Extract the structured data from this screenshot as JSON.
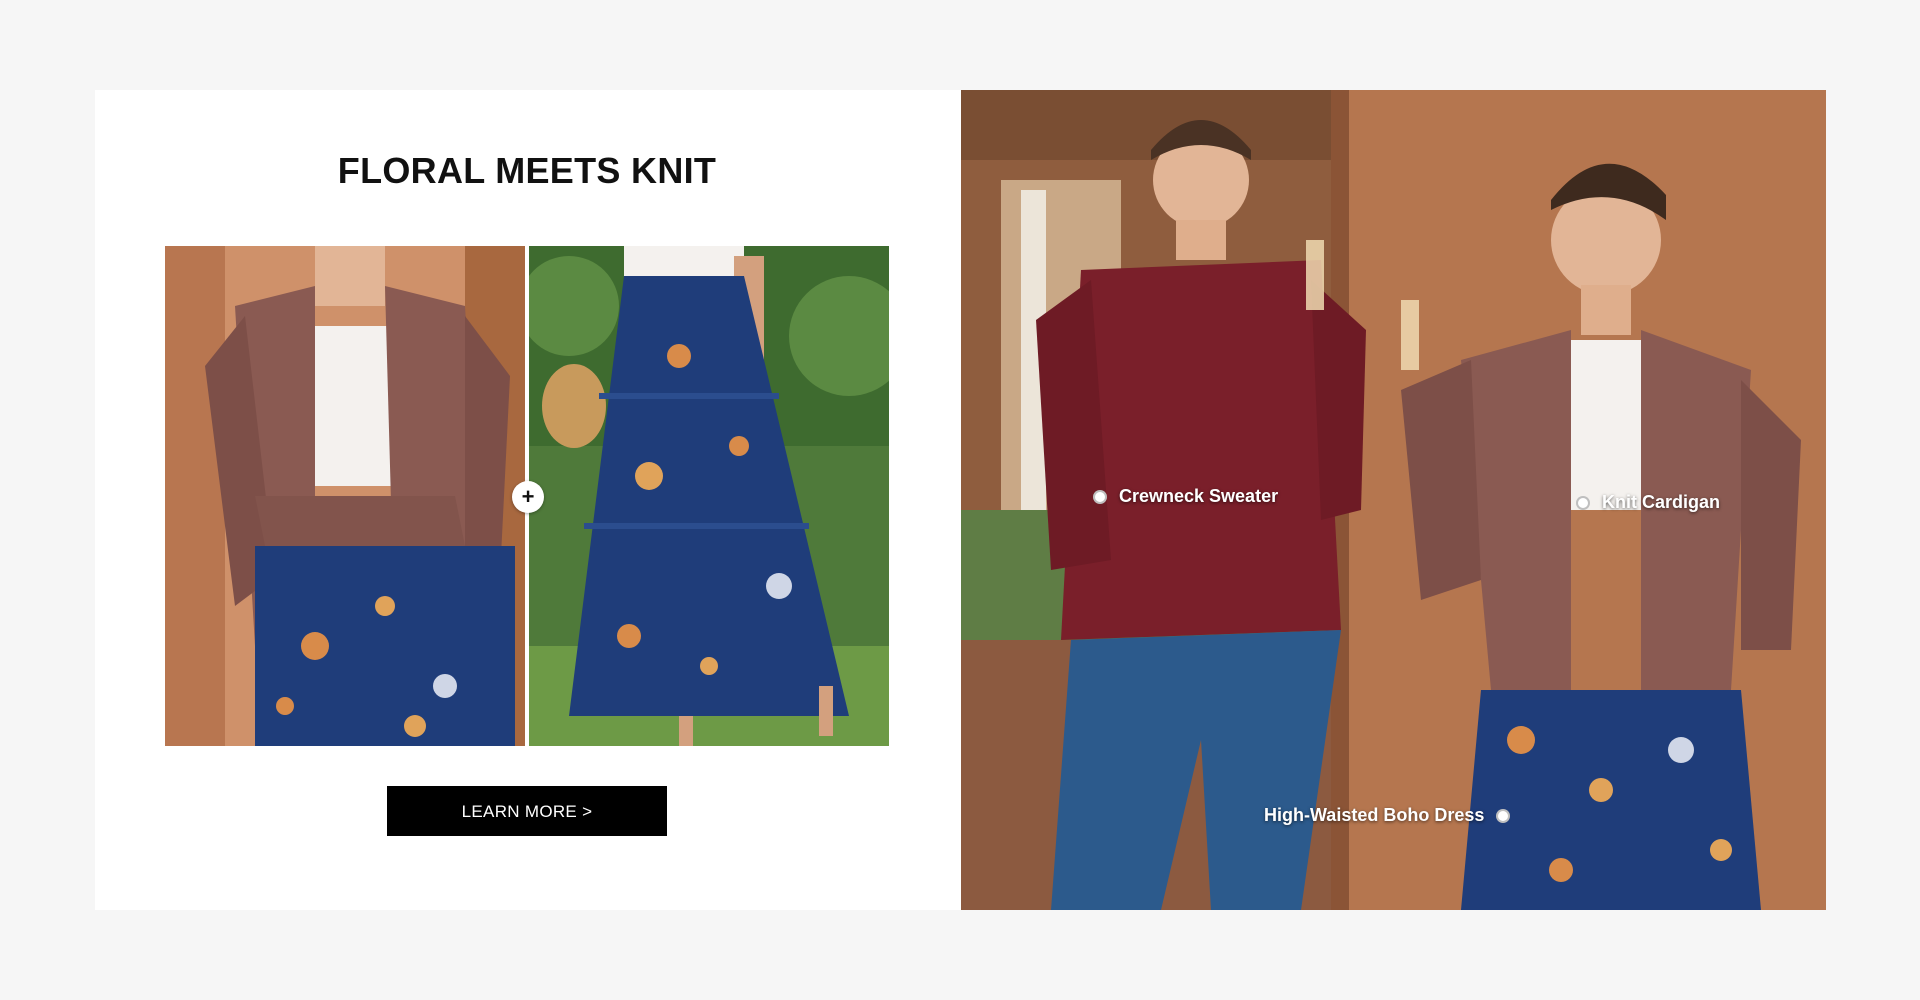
{
  "promo": {
    "headline": "FLORAL MEETS KNIT",
    "plus_symbol": "+",
    "cta_label": "LEARN MORE >"
  },
  "products": [
    {
      "name": "cardigan-look",
      "colors": {
        "knit": "#8a5a52",
        "top": "#f2efec",
        "skirt": "#1f3d7a"
      }
    },
    {
      "name": "floral-skirt-look",
      "colors": {
        "skirt": "#1f3d7a",
        "foliage": "#3e6b2f"
      }
    }
  ],
  "hotspots": [
    {
      "label": "Crewneck Sweater"
    },
    {
      "label": "Knit Cardigan"
    },
    {
      "label": "High-Waisted Boho Dress"
    }
  ],
  "colors": {
    "page_bg": "#f6f6f6",
    "card_bg": "#ffffff",
    "cta_bg": "#000000",
    "cta_text": "#ffffff",
    "sweater": "#7a1f2a",
    "cardigan": "#8a5a52",
    "denim": "#2c5a8c",
    "wood": "#b5764f"
  }
}
